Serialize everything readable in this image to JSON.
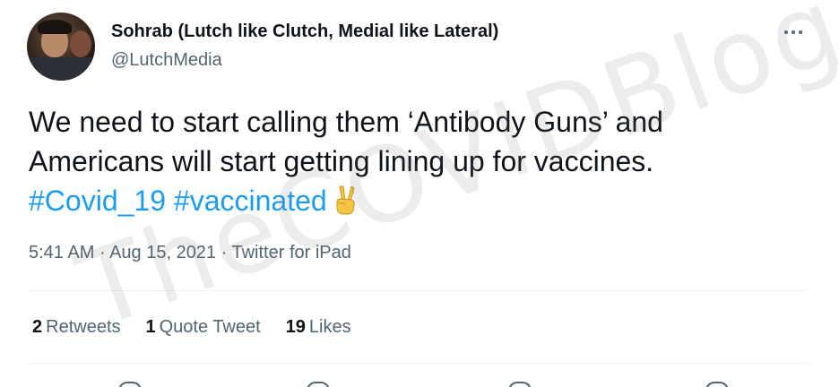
{
  "author": {
    "display_name": "Sohrab (Lutch like Clutch, Medial like Lateral)",
    "handle": "@LutchMedia"
  },
  "tweet": {
    "line1": "We need to start calling them ‘Antibody Guns’ and",
    "line2": "Americans will start getting lining up for vaccines.",
    "hashtags": [
      "#Covid_19",
      "#vaccinated"
    ],
    "emoji": "victory-hand-emoji"
  },
  "meta": {
    "time": "5:41 AM",
    "separator1": " · ",
    "date": "Aug 15, 2021",
    "separator2": " · ",
    "source": "Twitter for iPad"
  },
  "stats": {
    "retweets_count": "2",
    "retweets_label": "Retweets",
    "quotes_count": "1",
    "quotes_label": "Quote Tweet",
    "likes_count": "19",
    "likes_label": "Likes"
  },
  "watermark": "TheCOVIDBlog.com",
  "colors": {
    "text": "#0f1419",
    "secondary": "#536471",
    "link": "#1d9bf0",
    "divider": "#eff3f4"
  }
}
